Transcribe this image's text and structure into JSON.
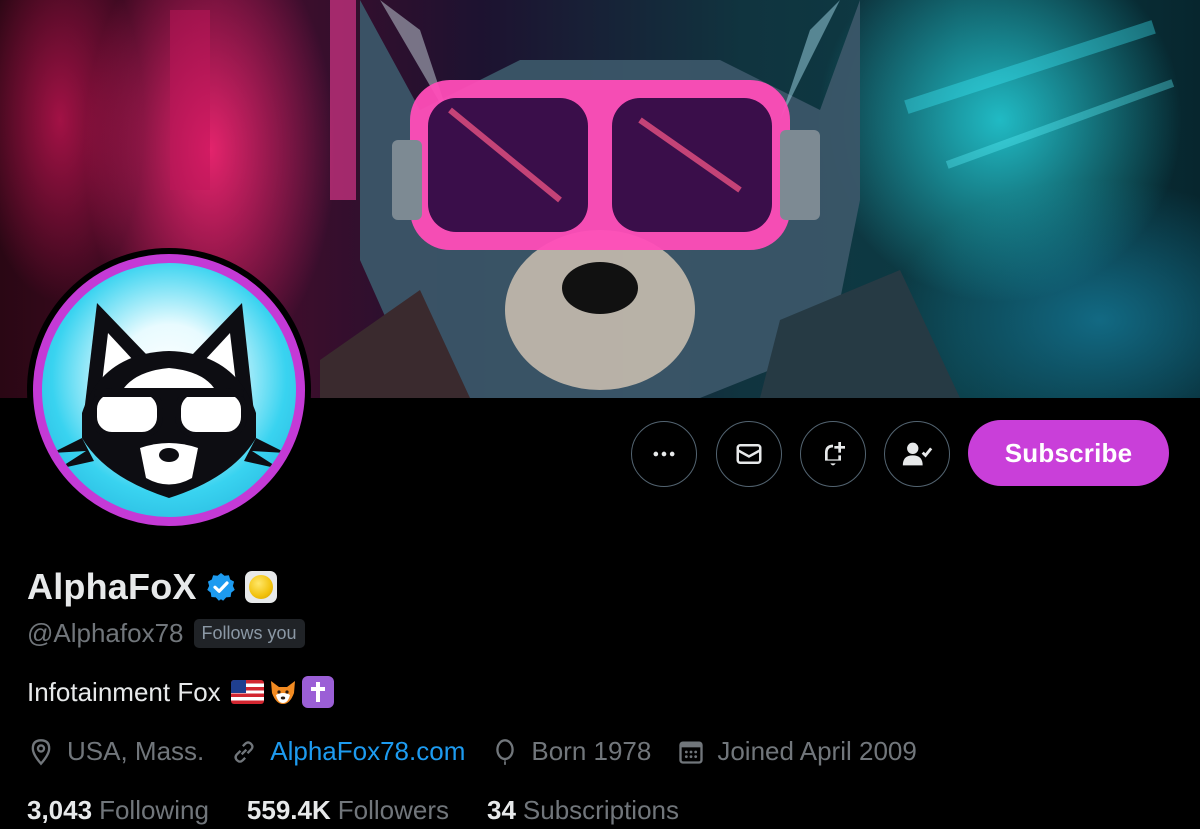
{
  "profile": {
    "display_name": "AlphaFoX",
    "handle": "@Alphafox78",
    "follows_you": "Follows you",
    "bio": "Infotainment Fox",
    "bio_emojis": [
      "us-flag",
      "fox-face",
      "latin-cross"
    ],
    "location": "USA, Mass.",
    "website": "AlphaFox78.com",
    "born": "Born 1978",
    "joined": "Joined April 2009"
  },
  "stats": {
    "following_count": "3,043",
    "following_label": "Following",
    "followers_count": "559.4K",
    "followers_label": "Followers",
    "subscriptions_count": "34",
    "subscriptions_label": "Subscriptions"
  },
  "actions": {
    "more_icon": "more-horizontal-icon",
    "message_icon": "envelope-icon",
    "notify_icon": "bell-plus-icon",
    "following_icon": "person-check-icon",
    "subscribe_label": "Subscribe"
  },
  "colors": {
    "background": "#000000",
    "accent_subscribe": "#c93fd9",
    "link": "#1d9bf0",
    "verified": "#1d9bf0",
    "secondary_text": "#71767b",
    "avatar_ring": "#c43ad6"
  }
}
